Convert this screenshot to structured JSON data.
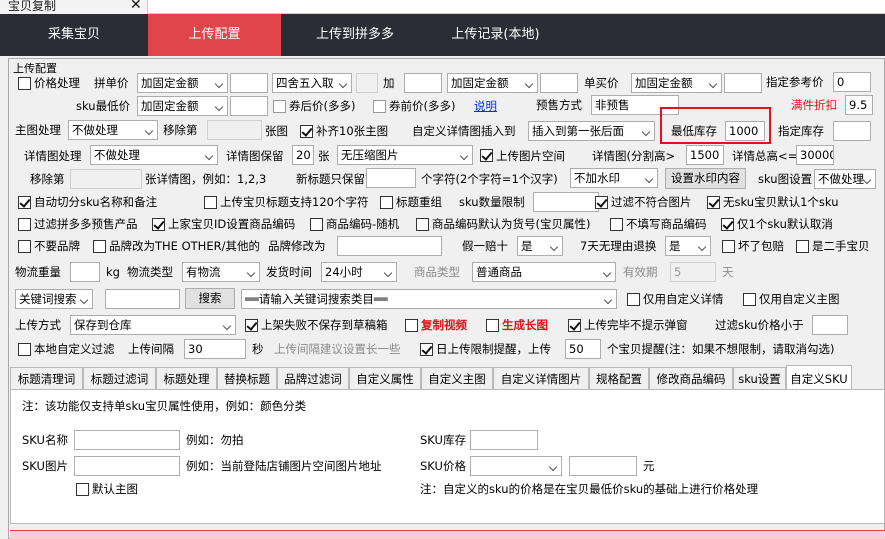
{
  "window": {
    "tab_title": "宝贝复制",
    "close_glyph": "✕"
  },
  "nav": [
    "采集宝贝",
    "上传配置",
    "上传到拼多多",
    "上传记录(本地)"
  ],
  "group_title": "上传配置",
  "row1": {
    "price_process": "价格处理",
    "group_price_label": "拼单价",
    "group_price_mode": "加固定金额",
    "group_price_val": "",
    "rounding": "四舍五入取",
    "plus": "加",
    "plus_mode": "加固定金额",
    "plus_val": "",
    "single_price_label": "单买价",
    "single_price_mode": "加固定金额",
    "single_price_val": "",
    "ref_price_label": "指定参考价",
    "ref_price_val": "0"
  },
  "row2": {
    "sku_min_label": "sku最低价",
    "sku_min_mode": "加固定金额",
    "sku_min_val": "",
    "coupon_after": "券后价(多多)",
    "coupon_before": "券前价(多多)",
    "explain": "说明",
    "presale_label": "预售方式",
    "presale_val": "非预售",
    "discount_label": "满件折扣",
    "discount_val": "9.5"
  },
  "row3": {
    "main_img_label": "主图处理",
    "main_img_mode": "不做处理",
    "remove_label": "移除第",
    "remove_val": "",
    "unit": "张图",
    "fill10": "补齐10张主图",
    "custom_detail_label": "自定义详情图插入到",
    "custom_detail_pos": "插入到第一张后面",
    "min_stock_label": "最低库存",
    "min_stock_val": "1000",
    "set_stock_label": "指定库存",
    "set_stock_val": ""
  },
  "row4": {
    "detail_label": "详情图处理",
    "detail_mode": "不做处理",
    "keep_label": "详情图保留",
    "keep_val": "20",
    "keep_unit": "张",
    "compress": "无压缩图片",
    "upload_space": "上传图片空间",
    "split_label": "详情图(分割高>",
    "split_val": "1500",
    "total_label": "详情总高<=",
    "total_val": "30000"
  },
  "row5": {
    "remove_label": "移除第",
    "remove_val": "",
    "sku_img_example": "张详情图，例如：1,2,3",
    "new_title_label": "新标题只保留前",
    "new_title_val": "",
    "char_note": "个字符(2个字符=1个汉字)",
    "watermark_mode": "不加水印",
    "watermark_btn": "设置水印内容",
    "sku_img_label": "sku图设置",
    "sku_img_mode": "不做处理"
  },
  "row6": {
    "auto_cut": "自动切分sku名称和备注",
    "title_120": "上传宝贝标题支持120个字符",
    "title_regroup": "标题重组",
    "sku_limit_label": "sku数量限制",
    "sku_limit_val": "",
    "filter_bad": "过滤不符合图片",
    "no_sku_default": "无sku宝贝默认1个sku"
  },
  "row7": {
    "filter_pdd_presale": "过滤拼多多预售产品",
    "upload_id_code": "上家宝贝ID设置商品编码",
    "code_random": "商品编码-随机",
    "code_default_goods": "商品编码默认为货号(宝贝属性)",
    "no_code": "不填写商品编码",
    "single_sku_cancel": "仅1个sku默认取消"
  },
  "row8": {
    "no_brand": "不要品牌",
    "brand_other": "品牌改为THE OTHER/其他的",
    "brand_change_label": "品牌修改为",
    "brand_change_val": "",
    "fake_label": "假一赔十",
    "fake_val": "是",
    "seven_day_label": "7天无理由退换",
    "seven_day_val": "是",
    "broken_pay": "坏了包赔",
    "second_hand": "是二手宝贝"
  },
  "row9": {
    "weight_label": "物流重量",
    "weight_val": "",
    "weight_unit": "kg",
    "logistics_label": "物流类型",
    "logistics_val": "有物流",
    "ship_label": "发货时间",
    "ship_val": "24小时",
    "goods_type_label": "商品类型",
    "goods_type_val": "普通商品",
    "valid_label": "有效期",
    "valid_val": "5",
    "valid_unit": "天"
  },
  "row10": {
    "keyword_mode": "关键词搜索",
    "keyword_val": "",
    "search_btn": "搜索",
    "category_placeholder": "══请输入关键词搜索类目══",
    "only_custom_detail": "仅用自定义详情",
    "only_custom_main": "仅用自定义主图"
  },
  "row11": {
    "upload_mode_label": "上传方式",
    "upload_mode_val": "保存到仓库",
    "fail_draft": "上架失败不保存到草稿箱",
    "copy_video": "复制视频",
    "gen_long_img": "生成长图",
    "no_popup": "上传完毕不提示弹窗",
    "filter_sku_price": "过滤sku价格小于",
    "filter_sku_price_val": ""
  },
  "row12": {
    "local_filter": "本地自定义过滤",
    "interval_label": "上传间隔",
    "interval_val": "30",
    "interval_unit": "秒",
    "interval_hint": "上传间隔建议设置长一些",
    "daily_limit": "日上传限制提醒，上传",
    "daily_limit_val": "50",
    "daily_note": "个宝贝提醒(注：如果不想限制，请取消勾选)"
  },
  "tabs": [
    "标题清理词",
    "标题过滤词",
    "标题处理",
    "替换标题",
    "品牌过滤词",
    "自定义属性",
    "自定义主图",
    "自定义详情图片",
    "规格配置",
    "修改商品编码",
    "sku设置",
    "自定义SKU"
  ],
  "panel": {
    "note": "注：该功能仅支持单sku宝贝属性使用，例如：颜色分类",
    "sku_name_label": "SKU名称",
    "sku_name_val": "",
    "sku_name_example": "例如：勿拍",
    "sku_stock_label": "SKU库存",
    "sku_stock_val": "",
    "sku_img_label": "SKU图片",
    "sku_img_val": "",
    "sku_img_example": "例如：当前登陆店铺图片空间图片地址",
    "sku_price_label": "SKU价格",
    "sku_price_mode": "",
    "sku_price_val": "",
    "yuan": "元",
    "default_main": "默认主图",
    "price_note": "注：自定义的sku的价格是在宝贝最低价sku的基础上进行价格处理"
  },
  "colors": {
    "nav_bg": "#2b2c36",
    "nav_active": "#e0454c",
    "highlight_box": "#e0121b",
    "link_blue": "#0033cc"
  }
}
